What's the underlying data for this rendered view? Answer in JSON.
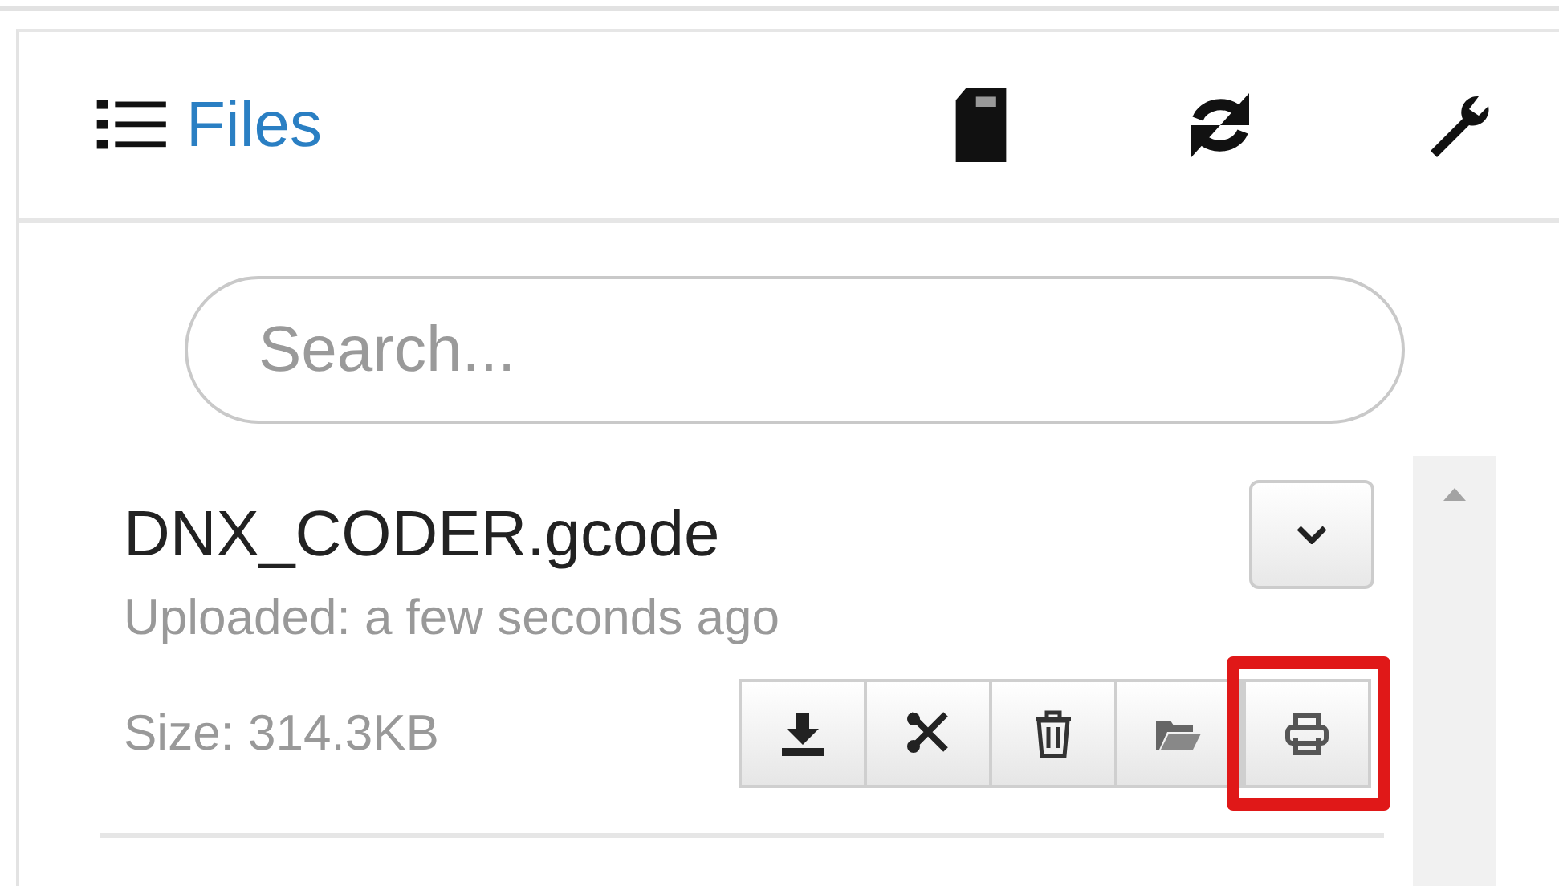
{
  "header": {
    "title": "Files",
    "tools": [
      {
        "kind": "sd"
      },
      {
        "kind": "refresh"
      },
      {
        "kind": "settings"
      }
    ]
  },
  "search": {
    "placeholder": "Search..."
  },
  "files": [
    {
      "name": "DNX_CODER.gcode",
      "uploaded": "Uploaded: a few seconds ago",
      "size": "Size: 314.3KB",
      "actions": [
        {
          "kind": "download",
          "highlighted": false
        },
        {
          "kind": "cut",
          "highlighted": false
        },
        {
          "kind": "delete",
          "highlighted": false
        },
        {
          "kind": "folder",
          "highlighted": false
        },
        {
          "kind": "print",
          "highlighted": true
        }
      ]
    }
  ]
}
